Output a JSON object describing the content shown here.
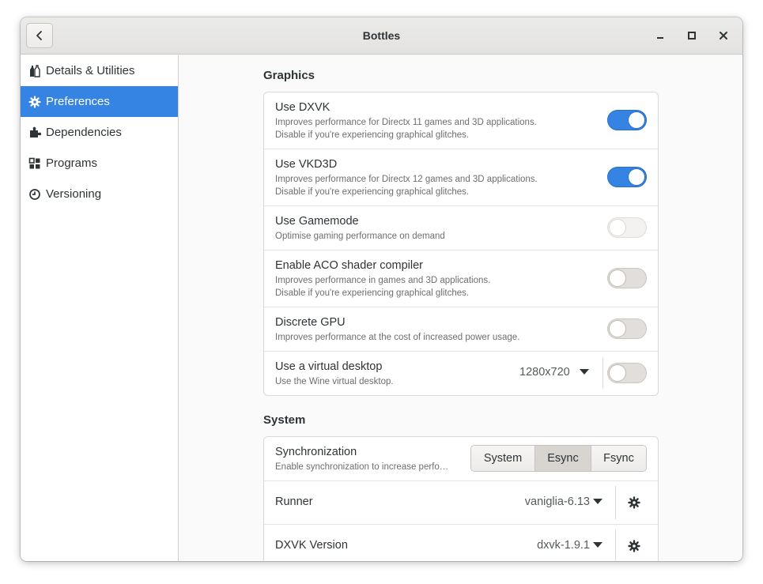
{
  "window": {
    "title": "Bottles"
  },
  "sidebar": {
    "items": [
      {
        "label": "Details & Utilities",
        "icon": "bottles-icon",
        "active": false
      },
      {
        "label": "Preferences",
        "icon": "gear-icon",
        "active": true
      },
      {
        "label": "Dependencies",
        "icon": "puzzle-icon",
        "active": false
      },
      {
        "label": "Programs",
        "icon": "grid-icon",
        "active": false
      },
      {
        "label": "Versioning",
        "icon": "clock-icon",
        "active": false
      }
    ]
  },
  "graphics": {
    "title": "Graphics",
    "rows": [
      {
        "title": "Use DXVK",
        "subtitle": "Improves performance for Directx 11 games and 3D applications.\nDisable if you're experiencing graphical glitches.",
        "enabled": true
      },
      {
        "title": "Use VKD3D",
        "subtitle": "Improves performance for Directx 12 games and 3D applications.\nDisable if you're experiencing graphical glitches.",
        "enabled": true
      },
      {
        "title": "Use Gamemode",
        "subtitle": "Optimise gaming performance on demand",
        "enabled": false
      },
      {
        "title": "Enable ACO shader compiler",
        "subtitle": "Improves performance in games and 3D applications.\nDisable if you're experiencing graphical glitches.",
        "enabled": false
      },
      {
        "title": "Discrete GPU",
        "subtitle": "Improves performance at the cost of increased power usage.",
        "enabled": false
      },
      {
        "title": "Use a virtual desktop",
        "subtitle": "Use the Wine virtual desktop.",
        "resolution": "1280x720",
        "enabled": false
      }
    ]
  },
  "system": {
    "title": "System",
    "synchronization": {
      "title": "Synchronization",
      "subtitle": "Enable synchronization to increase perfo…",
      "options": [
        "System",
        "Esync",
        "Fsync"
      ],
      "selected": "Esync"
    },
    "runner": {
      "title": "Runner",
      "value": "vaniglia-6.13"
    },
    "dxvk_version": {
      "title": "DXVK Version",
      "value": "dxvk-1.9.1"
    }
  },
  "colors": {
    "accent": "#3584e4",
    "headerbar": "#e8e7e5",
    "sidebar_bg": "#ffffff"
  }
}
